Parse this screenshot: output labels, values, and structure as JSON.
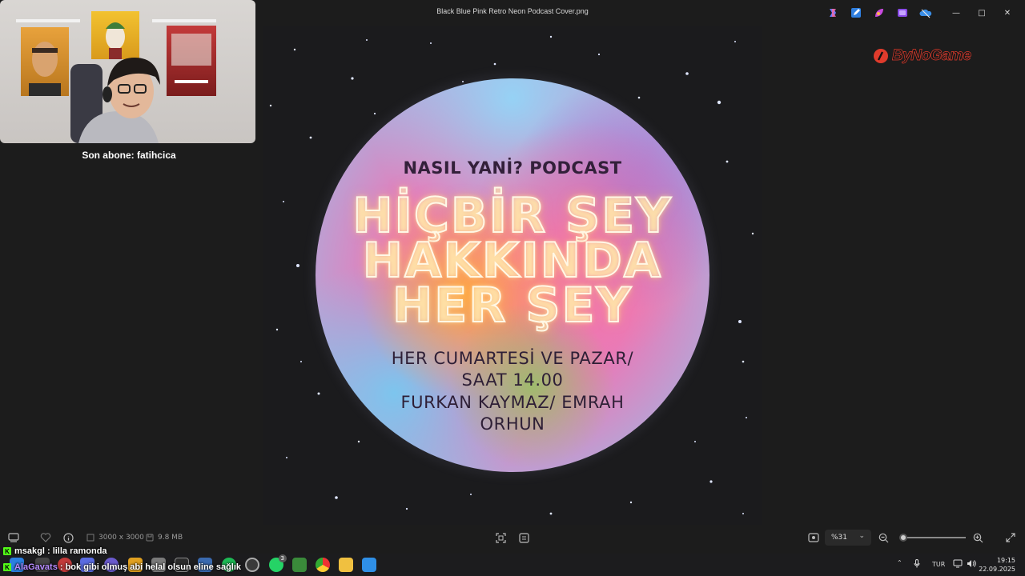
{
  "window": {
    "title": "Black Blue Pink Retro Neon Podcast Cover.png",
    "minimize": "—",
    "maximize": "□",
    "close": "✕"
  },
  "titlebar_icons": [
    "copilot-icon",
    "edit-icon",
    "paint-icon",
    "clipchamp-icon",
    "onedrive-icon"
  ],
  "webcam": {
    "subscriber_label": "Son abone: fatihcica"
  },
  "cover": {
    "podcast_name": "NASIL YANİ? PODCAST",
    "headline_1": "HİÇBİR ŞEY",
    "headline_2": "HAKKINDA",
    "headline_3": "HER ŞEY",
    "schedule_1": "HER CUMARTESİ VE PAZAR/",
    "schedule_2": "SAAT 14.00",
    "hosts_1": "FURKAN KAYMAZ/ EMRAH",
    "hosts_2": "ORHUN"
  },
  "brand": {
    "name": "ByNoGame",
    "accent": "#e03b2c"
  },
  "toolbar": {
    "dimensions": "3000 x 3000",
    "file_size": "9.8 MB",
    "zoom": "%31",
    "zoom_fraction": 0.05
  },
  "chat": [
    {
      "user": "msakgl",
      "message": " : lilla ramonda"
    },
    {
      "user": "AlaGavats",
      "message": " : bok gibi olmuş abi helal olsun eline sağlık"
    }
  ],
  "taskbar": {
    "language": "TUR",
    "time": "19:15",
    "date": "22.09.2025",
    "whatsapp_badge": "3"
  }
}
